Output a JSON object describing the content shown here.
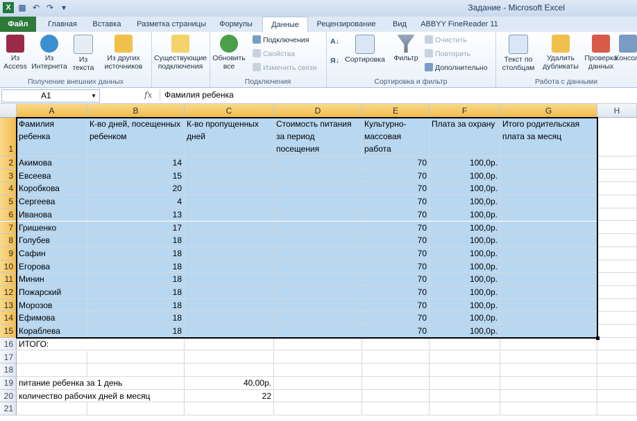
{
  "title": "Задание - Microsoft Excel",
  "qat_icons": [
    "excel-icon",
    "save-icon",
    "undo-icon",
    "redo-icon",
    "customize-icon"
  ],
  "tabs": [
    "Файл",
    "Главная",
    "Вставка",
    "Разметка страницы",
    "Формулы",
    "Данные",
    "Рецензирование",
    "Вид",
    "ABBYY FineReader 11"
  ],
  "active_tab": "Данные",
  "ribbon": {
    "group_external": {
      "label": "Получение внешних данных",
      "from_access": "Из\nAccess",
      "from_web": "Из\nИнтернета",
      "from_text": "Из\nтекста",
      "from_other": "Из других\nисточников",
      "existing": "Существующие\nподключения"
    },
    "group_connections": {
      "label": "Подключения",
      "refresh_all": "Обновить\nвсе",
      "connections": "Подключения",
      "properties": "Свойства",
      "edit_links": "Изменить связи"
    },
    "group_sort": {
      "label": "Сортировка и фильтр",
      "sort": "Сортировка",
      "filter": "Фильтр",
      "clear": "Очистить",
      "reapply": "Повторить",
      "advanced": "Дополнительно"
    },
    "group_tools": {
      "label": "Работа с данными",
      "text_to_columns": "Текст по\nстолбцам",
      "remove_dup": "Удалить\nдубликаты",
      "validation": "Проверка\nданных",
      "consolidate": "Консол"
    }
  },
  "formula_bar": {
    "name_box": "A1",
    "fx": "fx",
    "content": "Фамилия ребенка"
  },
  "columns": [
    "A",
    "B",
    "C",
    "D",
    "E",
    "F",
    "G",
    "H"
  ],
  "header_row": [
    "Фамилия ребенка",
    "К-во дней, посещенных ребенком",
    "К-во пропущенных дней",
    "Стоимость питания за период посещения",
    "Культурно-массовая работа",
    "Плата за охрану",
    "Итого родительская плата за месяц"
  ],
  "rows": [
    {
      "n": "2",
      "name": "Акимова",
      "days": "14",
      "culture": "70",
      "guard": "100,0р."
    },
    {
      "n": "3",
      "name": "Евсеева",
      "days": "15",
      "culture": "70",
      "guard": "100,0р."
    },
    {
      "n": "4",
      "name": "Коробкова",
      "days": "20",
      "culture": "70",
      "guard": "100,0р."
    },
    {
      "n": "5",
      "name": "Сергеева",
      "days": "4",
      "culture": "70",
      "guard": "100,0р."
    },
    {
      "n": "6",
      "name": "Иванова",
      "days": "13",
      "culture": "70",
      "guard": "100,0р."
    },
    {
      "n": "7",
      "name": "Гришенко",
      "days": "17",
      "culture": "70",
      "guard": "100,0р."
    },
    {
      "n": "8",
      "name": "Голубев",
      "days": "18",
      "culture": "70",
      "guard": "100,0р."
    },
    {
      "n": "9",
      "name": "Сафин",
      "days": "18",
      "culture": "70",
      "guard": "100,0р."
    },
    {
      "n": "10",
      "name": "Егорова",
      "days": "18",
      "culture": "70",
      "guard": "100,0р."
    },
    {
      "n": "11",
      "name": "Минин",
      "days": "18",
      "culture": "70",
      "guard": "100,0р."
    },
    {
      "n": "12",
      "name": "Пожарский",
      "days": "18",
      "culture": "70",
      "guard": "100,0р."
    },
    {
      "n": "13",
      "name": "Морозов",
      "days": "18",
      "culture": "70",
      "guard": "100,0р."
    },
    {
      "n": "14",
      "name": "Ефимова",
      "days": "18",
      "culture": "70",
      "guard": "100,0р."
    },
    {
      "n": "15",
      "name": "Кораблева",
      "days": "18",
      "culture": "70",
      "guard": "100,0р."
    }
  ],
  "extra_rows": [
    {
      "n": "16",
      "a": "ИТОГО:",
      "c": ""
    },
    {
      "n": "17",
      "a": "",
      "c": ""
    },
    {
      "n": "18",
      "a": "",
      "c": ""
    },
    {
      "n": "19",
      "a": "питание ребенка за 1 день",
      "c": "40,00р."
    },
    {
      "n": "20",
      "a": "количество рабочих дней в месяц",
      "c": "22"
    },
    {
      "n": "21",
      "a": "",
      "c": ""
    }
  ],
  "colors": {
    "selection_fill": "#b8d7f0",
    "file_tab": "#2d7a3a"
  }
}
